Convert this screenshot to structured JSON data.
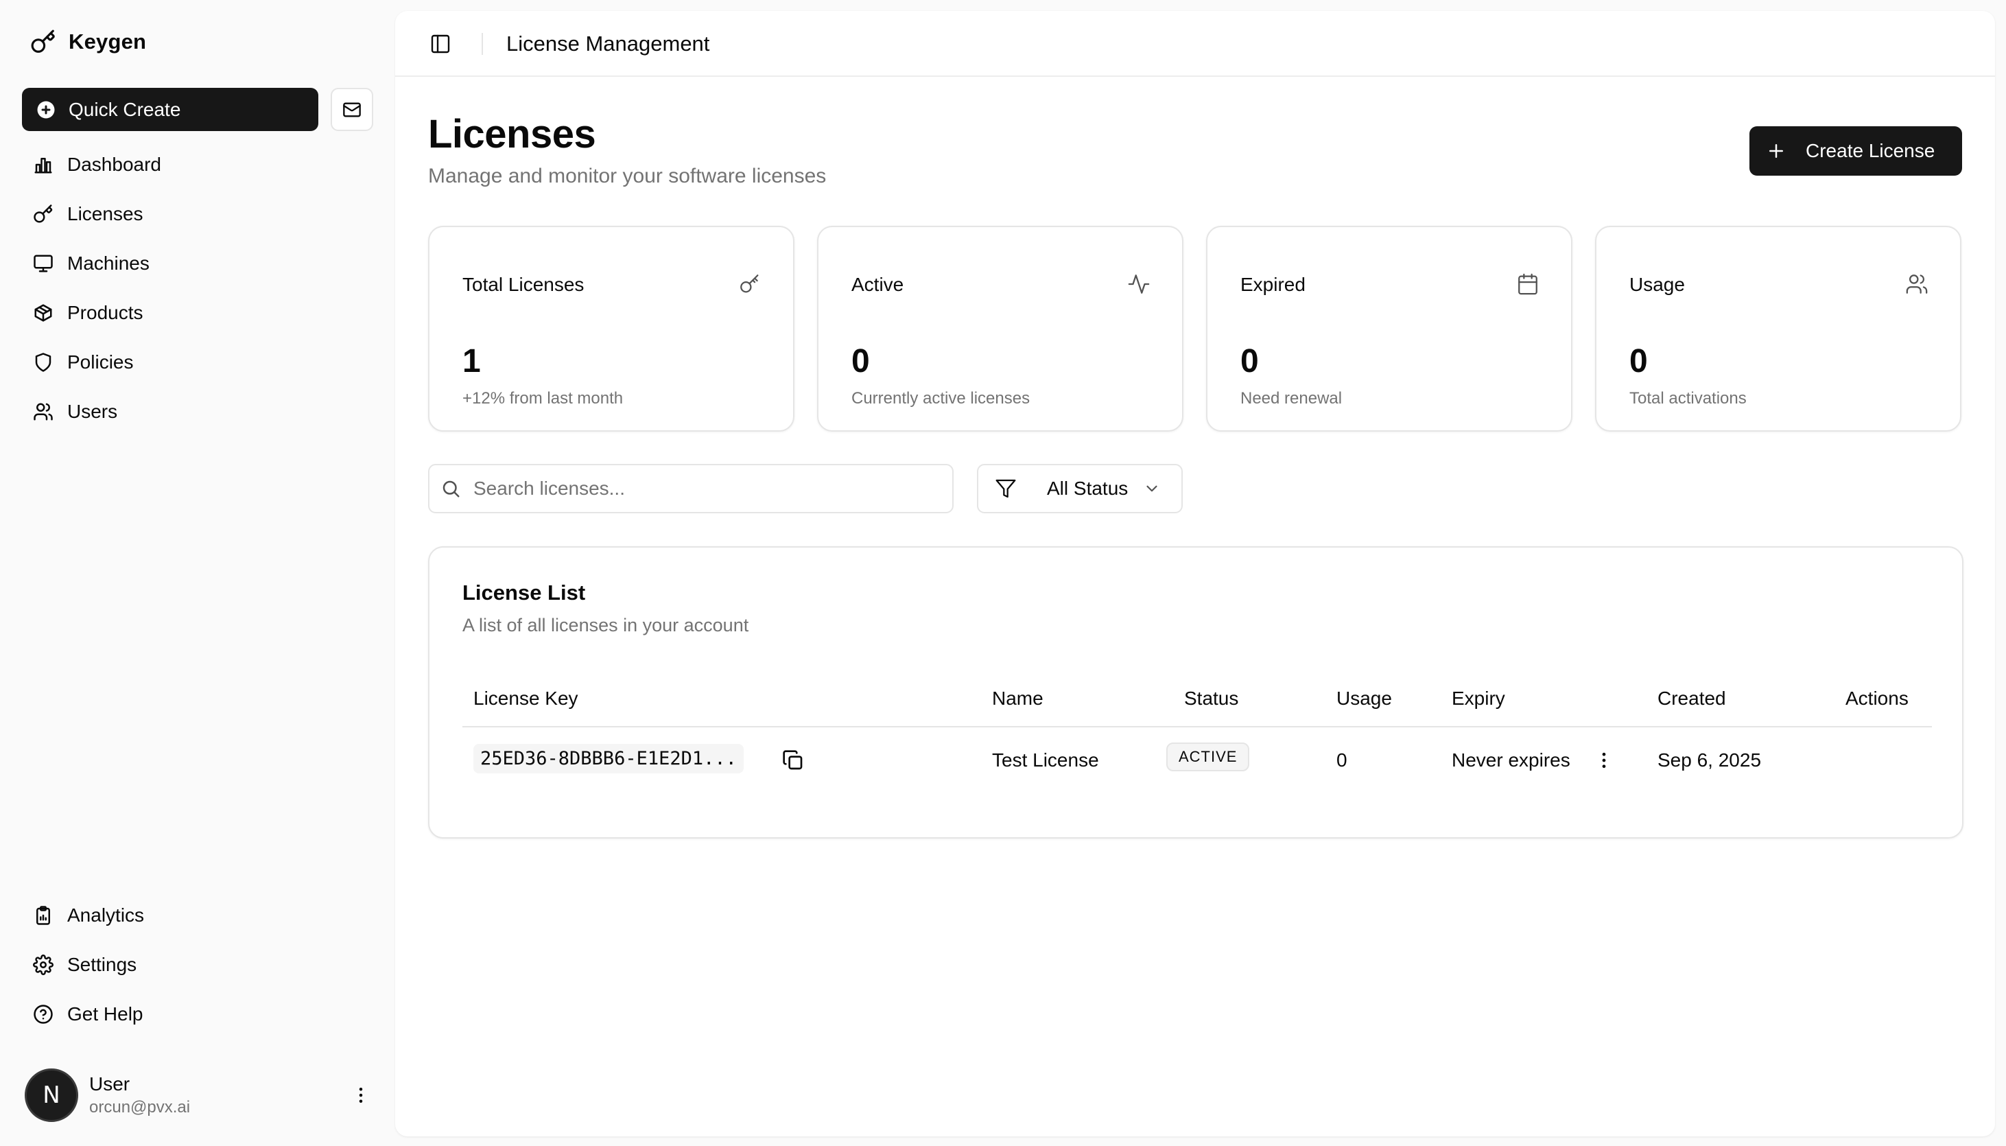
{
  "brand": {
    "name": "Keygen",
    "icon": "key-icon"
  },
  "sidebar": {
    "quick_create": "Quick Create",
    "inbox_icon": "mail-icon",
    "nav": [
      {
        "label": "Dashboard",
        "icon": "bar-chart-icon"
      },
      {
        "label": "Licenses",
        "icon": "key-icon"
      },
      {
        "label": "Machines",
        "icon": "monitor-icon"
      },
      {
        "label": "Products",
        "icon": "package-icon"
      },
      {
        "label": "Policies",
        "icon": "shield-icon"
      },
      {
        "label": "Users",
        "icon": "users-icon"
      }
    ],
    "secondary": [
      {
        "label": "Analytics",
        "icon": "clipboard-icon"
      },
      {
        "label": "Settings",
        "icon": "gear-icon"
      },
      {
        "label": "Get Help",
        "icon": "help-circle-icon"
      }
    ],
    "user": {
      "initial": "N",
      "name": "User",
      "email": "orcun@pvx.ai"
    }
  },
  "topbar": {
    "title": "License Management"
  },
  "page": {
    "title": "Licenses",
    "subtitle": "Manage and monitor your software licenses",
    "create_label": "Create License"
  },
  "stats": [
    {
      "title": "Total Licenses",
      "value": "1",
      "note": "+12% from last month",
      "icon": "key-icon"
    },
    {
      "title": "Active",
      "value": "0",
      "note": "Currently active licenses",
      "icon": "activity-icon"
    },
    {
      "title": "Expired",
      "value": "0",
      "note": "Need renewal",
      "icon": "calendar-icon"
    },
    {
      "title": "Usage",
      "value": "0",
      "note": "Total activations",
      "icon": "users-icon"
    }
  ],
  "filters": {
    "search_placeholder": "Search licenses...",
    "status_value": "All Status"
  },
  "license_list": {
    "title": "License List",
    "description": "A list of all licenses in your account",
    "columns": [
      "License Key",
      "Name",
      "Status",
      "Usage",
      "Expiry",
      "Created",
      "Actions"
    ],
    "rows": [
      {
        "key": "25ED36-8DBBB6-E1E2D1...",
        "name": "Test License",
        "status": "ACTIVE",
        "usage": "0",
        "expiry": "Never expires",
        "created": "Sep 6, 2025"
      }
    ]
  },
  "colors": {
    "primary": "#171717",
    "muted_text": "#737373",
    "border": "#e5e5e5",
    "background": "#fafafa"
  }
}
